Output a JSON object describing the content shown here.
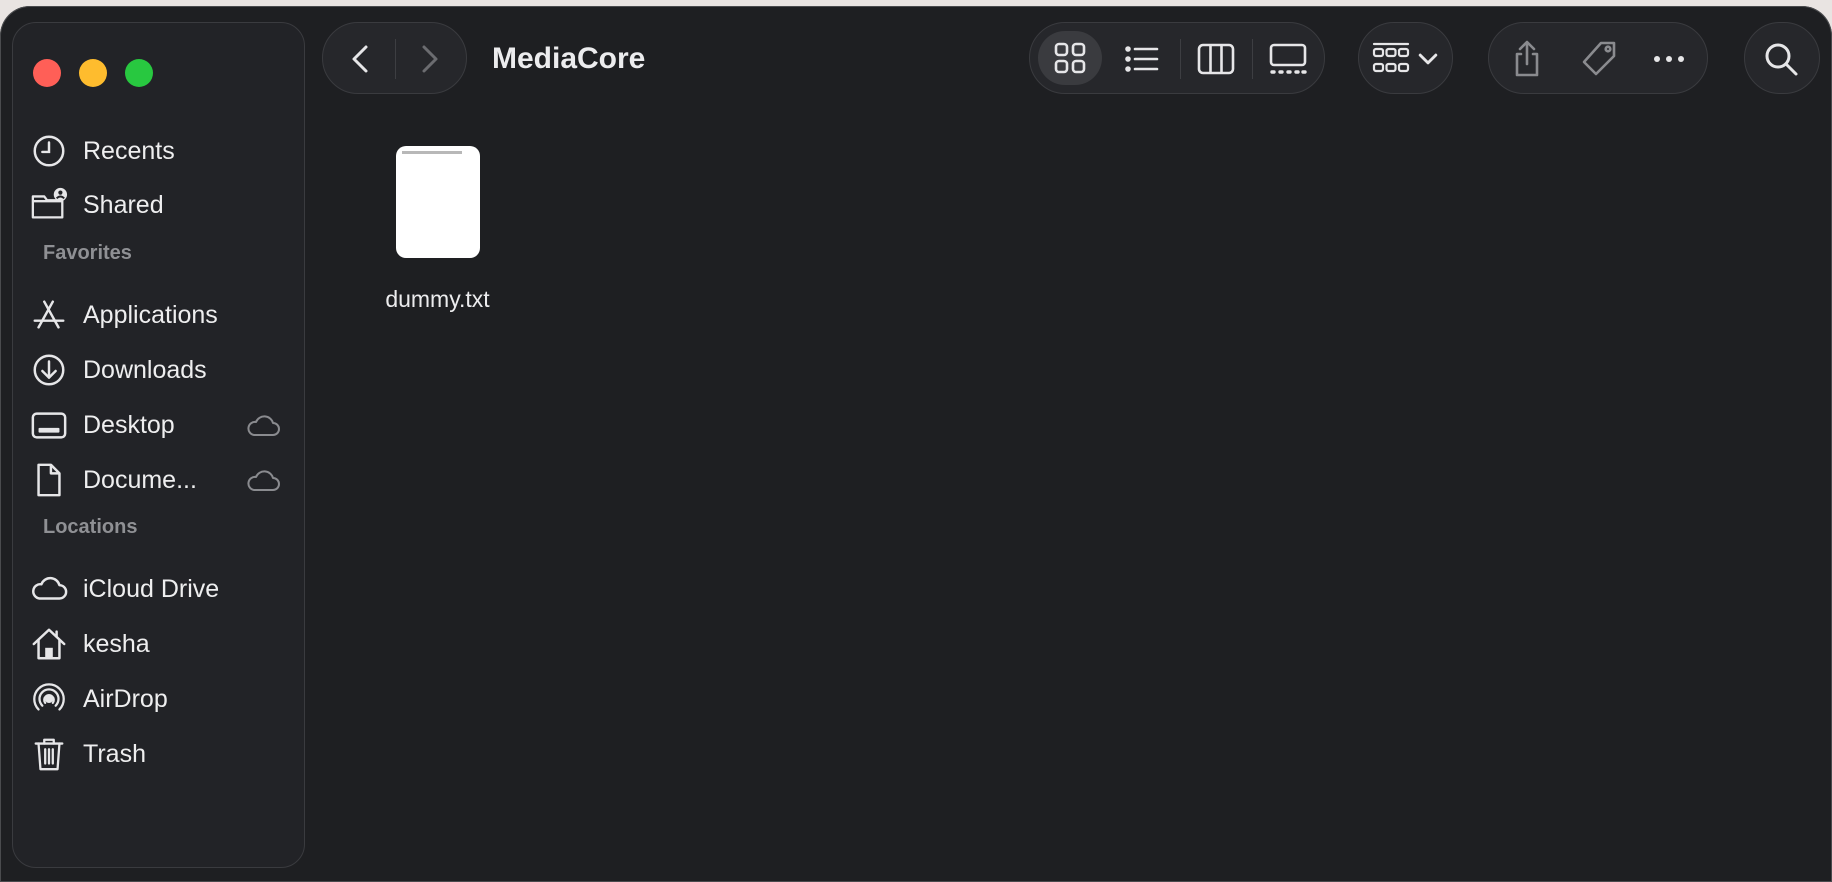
{
  "window": {
    "title": "MediaCore"
  },
  "sidebar": {
    "top_items": [
      {
        "label": "Recents",
        "icon": "clock-icon"
      },
      {
        "label": "Shared",
        "icon": "shared-folder-icon"
      }
    ],
    "favorites_header": "Favorites",
    "favorites": [
      {
        "label": "Applications",
        "icon": "applications-icon"
      },
      {
        "label": "Downloads",
        "icon": "download-circle-icon"
      },
      {
        "label": "Desktop",
        "icon": "desktop-icon",
        "cloud": true
      },
      {
        "label": "Docume...",
        "icon": "document-icon",
        "cloud": true
      }
    ],
    "locations_header": "Locations",
    "locations": [
      {
        "label": "iCloud Drive",
        "icon": "cloud-icon"
      },
      {
        "label": "kesha",
        "icon": "home-icon"
      },
      {
        "label": "AirDrop",
        "icon": "airdrop-icon"
      },
      {
        "label": "Trash",
        "icon": "trash-icon"
      }
    ]
  },
  "toolbar": {
    "view_modes": [
      "icon-view",
      "list-view",
      "column-view",
      "gallery-view"
    ],
    "active_view": "icon-view",
    "group_menu": "group-by",
    "actions": [
      "share",
      "tag",
      "more"
    ],
    "search": "search"
  },
  "files": [
    {
      "name": "dummy.txt",
      "kind": "text"
    }
  ],
  "colors": {
    "window_bg": "#1e1f22",
    "sidebar_bg": "#222327",
    "close": "#ff5f57",
    "minimize": "#febc2e",
    "zoom": "#28c840",
    "text": "#ececee",
    "muted": "#8f9094"
  }
}
